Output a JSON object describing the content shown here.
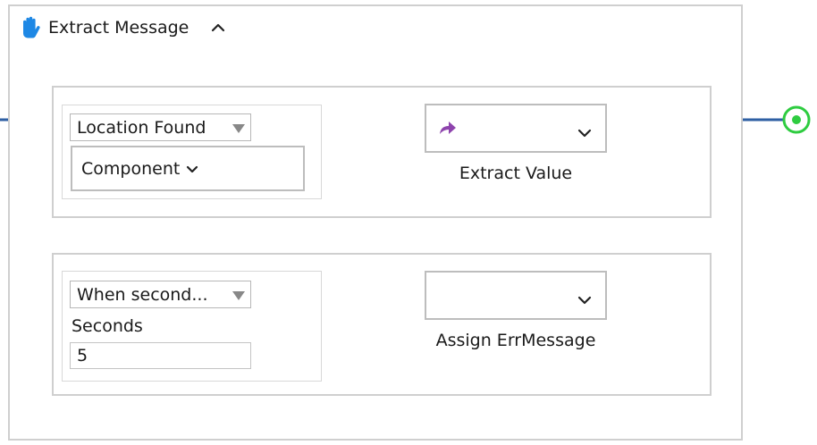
{
  "block": {
    "title": "Extract Message",
    "icon": "hand-icon",
    "collapse_icon": "chevron-up-icon"
  },
  "branch1": {
    "condition_select": "Location Found",
    "component_select": "Component",
    "action_icon": "redirect-arrow-icon",
    "action_label": "Extract Value"
  },
  "branch2": {
    "condition_select": "When second...",
    "seconds_label": "Seconds",
    "seconds_value": "5",
    "action_label": "Assign ErrMessage"
  },
  "colors": {
    "wire": "#2e5fa3",
    "end_node": "#2ecc40",
    "hand_icon": "#1e88e5",
    "action_arrow": "#8e44ad",
    "frame_border": "#cfcfcf"
  }
}
